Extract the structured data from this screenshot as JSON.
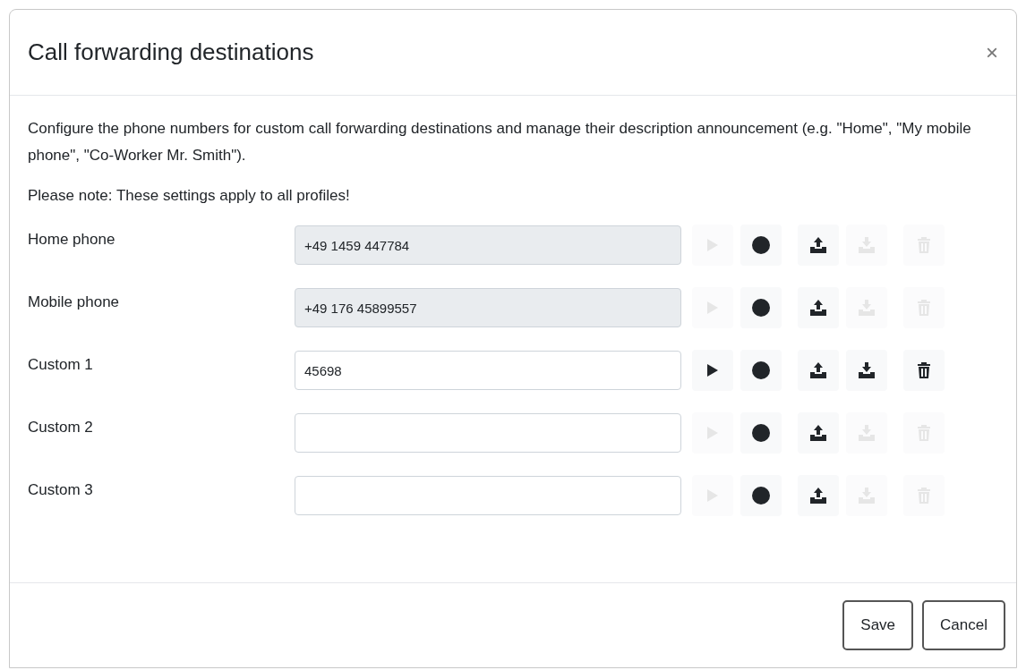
{
  "dialog": {
    "title": "Call forwarding destinations",
    "close": "×"
  },
  "intro": "Configure the phone numbers for custom call forwarding destinations and manage their description announcement (e.g. \"Home\", \"My mobile phone\", \"Co-Worker Mr. Smith\").",
  "note": "Please note: These settings apply to all profiles!",
  "rows": [
    {
      "label": "Home phone",
      "value": "+49 1459 447784",
      "readonly": true,
      "play_disabled": true,
      "download_disabled": true,
      "delete_disabled": true
    },
    {
      "label": "Mobile phone",
      "value": "+49 176 45899557",
      "readonly": true,
      "play_disabled": true,
      "download_disabled": true,
      "delete_disabled": true
    },
    {
      "label": "Custom 1",
      "value": "45698",
      "readonly": false,
      "play_disabled": false,
      "download_disabled": false,
      "delete_disabled": false
    },
    {
      "label": "Custom 2",
      "readonly": false,
      "play_disabled": true,
      "download_disabled": true,
      "delete_disabled": true
    },
    {
      "label": "Custom 3",
      "readonly": false,
      "play_disabled": true,
      "download_disabled": true,
      "delete_disabled": true
    }
  ],
  "buttons": [
    "Save",
    "Cancel"
  ]
}
